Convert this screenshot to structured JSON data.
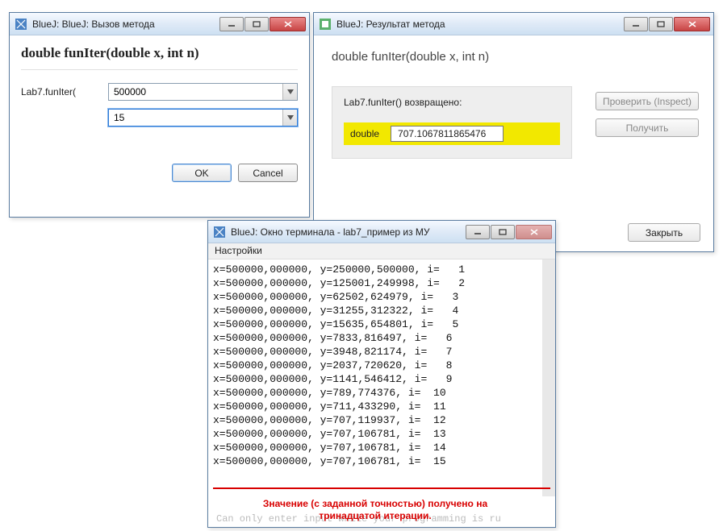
{
  "w1": {
    "title": "BlueJ:  BlueJ: Вызов метода",
    "signature": "double funIter(double x, int n)",
    "prefix": "Lab7.funIter(",
    "arg1": "500000",
    "arg2": "15",
    "ok": "OK",
    "cancel": "Cancel"
  },
  "w2": {
    "title": "BlueJ: Результат метода",
    "signature": "double funIter(double x, int n)",
    "returned": "Lab7.funIter() возвращено:",
    "type": "double",
    "value": "707.1067811865476",
    "inspect": "Проверить (Inspect)",
    "get": "Получить",
    "close": "Закрыть"
  },
  "w3": {
    "title": "BlueJ: Окно терминала - lab7_пример из МУ",
    "menu": "Настройки",
    "lines": [
      "x=500000,000000, y=250000,500000, i=   1",
      "x=500000,000000, y=125001,249998, i=   2",
      "x=500000,000000, y=62502,624979, i=   3",
      "x=500000,000000, y=31255,312322, i=   4",
      "x=500000,000000, y=15635,654801, i=   5",
      "x=500000,000000, y=7833,816497, i=   6",
      "x=500000,000000, y=3948,821174, i=   7",
      "x=500000,000000, y=2037,720620, i=   8",
      "x=500000,000000, y=1141,546412, i=   9",
      "x=500000,000000, y=789,774376, i=  10",
      "x=500000,000000, y=711,433290, i=  11",
      "x=500000,000000, y=707,119937, i=  12",
      "x=500000,000000, y=707,106781, i=  13",
      "x=500000,000000, y=707,106781, i=  14",
      "x=500000,000000, y=707,106781, i=  15"
    ],
    "grey_footer": "Can only enter input while your programming is ru",
    "red_note_l1": "Значение (с заданной точностью) получено на",
    "red_note_l2": "тринадцатой итерации."
  }
}
